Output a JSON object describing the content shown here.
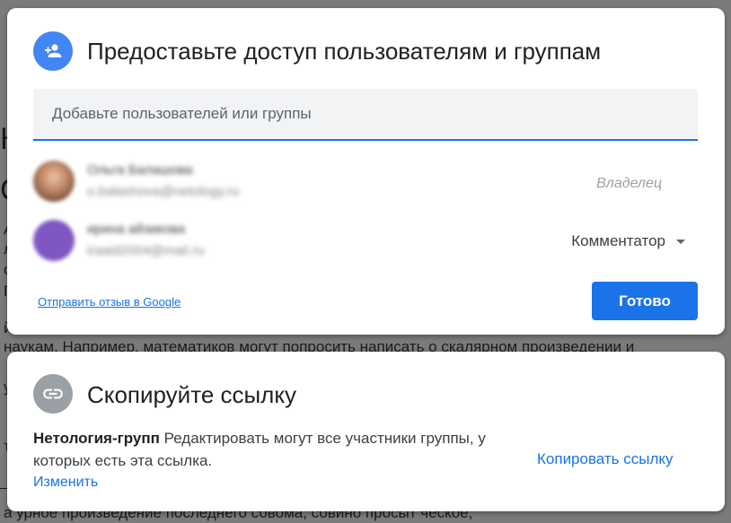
{
  "background": {
    "lines": [
      {
        "text": "К"
      },
      {
        "text": "С"
      },
      {
        "text": "А"
      },
      {
        "text": "л"
      },
      {
        "text": "о"
      },
      {
        "text": "П"
      },
      {
        "text": "й"
      },
      {
        "text": "наукам. Например, математиков могут попросить написать о скалярном произведении и"
      },
      {
        "text": "у"
      },
      {
        "text": "ту"
      },
      {
        "text": "а урное произведение последнего совома, совино просыт ческое,"
      }
    ]
  },
  "share_dialog": {
    "title": "Предоставьте доступ пользователям и группам",
    "add_placeholder": "Добавьте пользователей или группы",
    "people": [
      {
        "name": "Ольга Балашова",
        "email": "o.balashova@netology.ru",
        "role": "Владелец"
      },
      {
        "name": "ирина айзикова",
        "email": "iraaid2004@mail.ru",
        "role": "Комментатор"
      }
    ],
    "feedback_link": "Отправить отзыв в Google",
    "done_button": "Готово"
  },
  "link_dialog": {
    "title": "Скопируйте ссылку",
    "group_name": "Нетология-групп",
    "description": "Редактировать могут все участники группы, у которых есть эта ссылка.",
    "change_link": "Изменить",
    "copy_button": "Копировать ссылку"
  },
  "colors": {
    "accent": "#1a73e8",
    "share_icon_bg": "#4285f4",
    "link_icon_bg": "#9aa0a6"
  },
  "icons": {
    "share": "person-add-icon",
    "link": "link-icon"
  }
}
